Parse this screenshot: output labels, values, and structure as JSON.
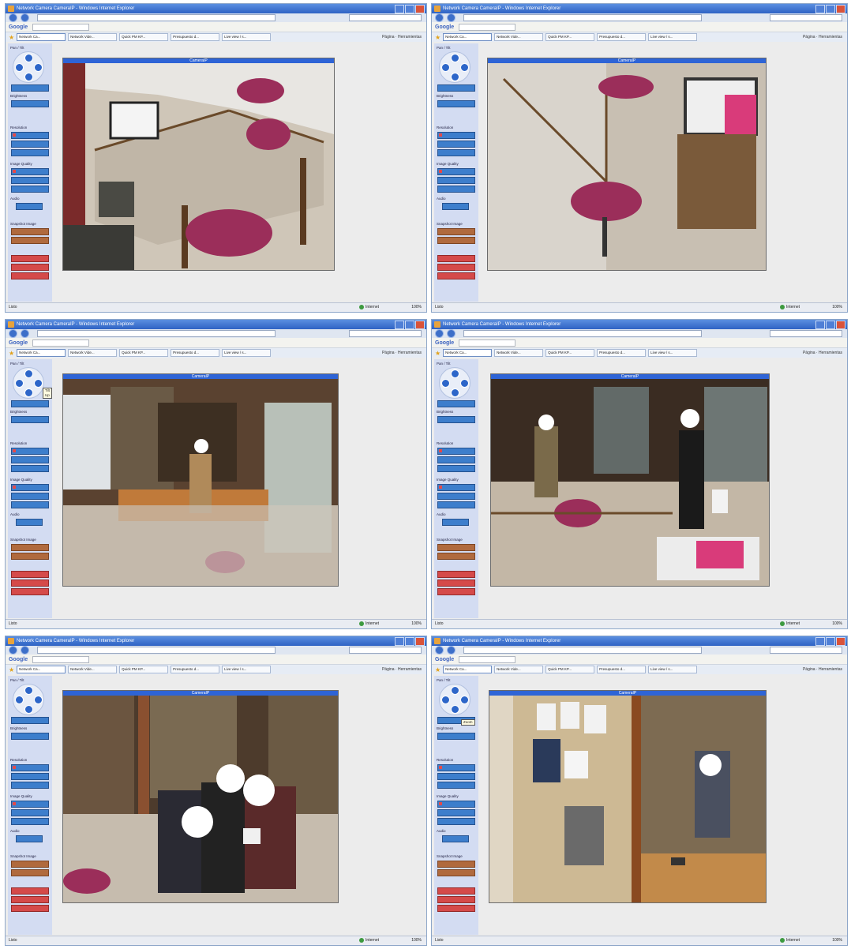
{
  "window_title": "Network Camera CameraIP - Windows Internet Explorer",
  "google_label": "Google",
  "tabs": [
    "Network Ca...",
    "Network Vide...",
    "Quick PM KP...",
    "Presupuesto d...",
    "Live view / s..."
  ],
  "toolbar_right": "Página · Herramientas",
  "status_left": "Listo",
  "status_zone": "Internet",
  "status_zoom": "100%",
  "viewer_title": "CameraIP",
  "panel": {
    "pan_tilt_label": "Pan / Tilt",
    "pan_scan": "Pan Scan",
    "brightness_label": "Brightness",
    "brightness_value": "- 100% +",
    "resolution_label": "Resolution",
    "resolutions": [
      "640x480",
      "320x240",
      "160x120"
    ],
    "image_quality_label": "Image Quality",
    "qualities": [
      "Normal Clarity",
      "Standard",
      "Normal Motion"
    ],
    "audio_label": "Audio",
    "audio_value": "ON  OFF",
    "snapshot_label": "Snapshot Image",
    "snapshot_buttons": [
      "Save Picture",
      "Refresh"
    ],
    "ptz_buttons": [
      "Home Camera",
      "Go Right",
      "Exit"
    ]
  },
  "screens": [
    {
      "id": "s1",
      "tooltip": ""
    },
    {
      "id": "s2",
      "tooltip": ""
    },
    {
      "id": "s3",
      "tooltip": "Tilt Up"
    },
    {
      "id": "s4",
      "tooltip": ""
    },
    {
      "id": "s5",
      "tooltip": ""
    },
    {
      "id": "s6",
      "tooltip": "Zoom"
    }
  ]
}
